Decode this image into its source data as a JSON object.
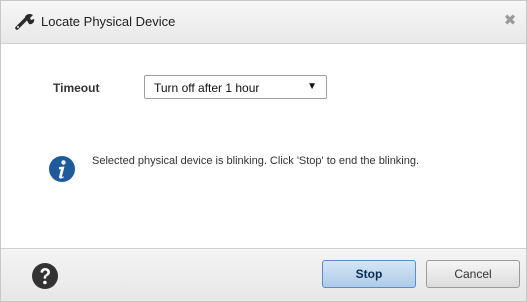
{
  "dialog": {
    "title": "Locate Physical Device",
    "close_glyph": "✖"
  },
  "timeout": {
    "label": "Timeout",
    "selected": "Turn off after 1 hour",
    "arrow": "▼"
  },
  "message": {
    "text": "Selected physical device is blinking. Click 'Stop' to end the blinking."
  },
  "footer": {
    "stop_label": "Stop",
    "cancel_label": "Cancel"
  },
  "icons": {
    "title": "wrench-icon",
    "info": "info-icon",
    "help": "help-icon"
  },
  "colors": {
    "info_blue": "#1e5a9c",
    "help_dark": "#333333",
    "primary_border": "#5b8ec4"
  }
}
